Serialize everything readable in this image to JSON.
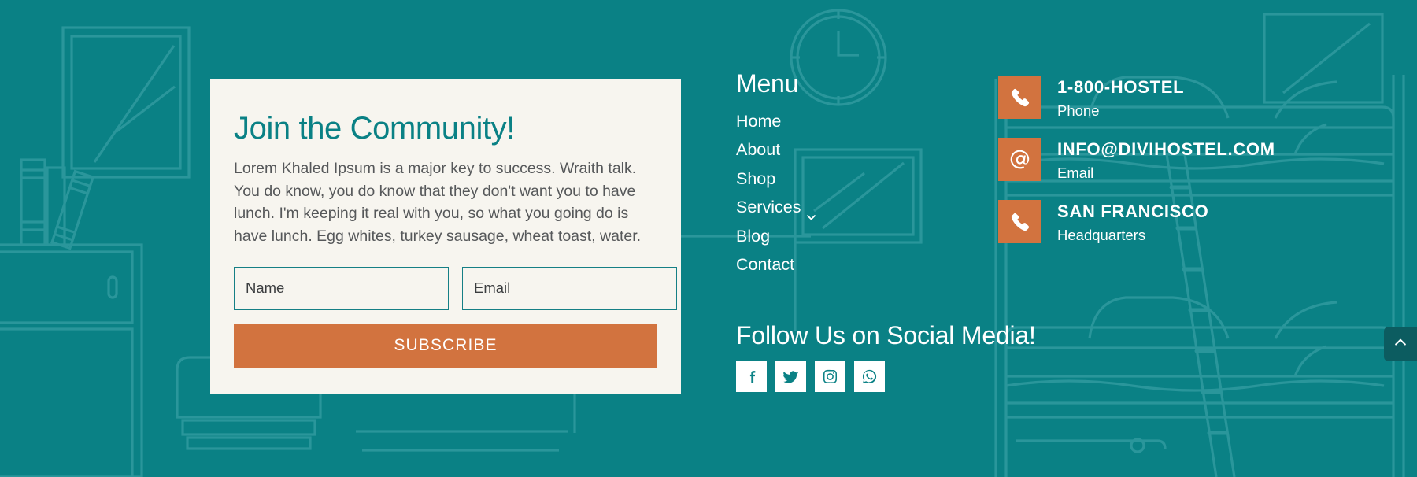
{
  "theme": {
    "teal": "#0a8185",
    "teal_dark": "#0c5c60",
    "orange": "#d2733f",
    "cream": "#f7f5ef",
    "white": "#ffffff",
    "body_text": "#56585a"
  },
  "subscribe_card": {
    "title": "Join the Community!",
    "body": "Lorem Khaled Ipsum is a major key to success. Wraith talk. You do know, you do know that they don't want you to have lunch. I'm keeping it real with you, so what you going do is have lunch. Egg whites, turkey sausage, wheat toast, water.",
    "name_field": {
      "value": "",
      "placeholder": "Name"
    },
    "email_field": {
      "value": "",
      "placeholder": "Email"
    },
    "submit_label": "SUBSCRIBE"
  },
  "menu": {
    "heading": "Menu",
    "items": [
      {
        "label": "Home",
        "has_submenu": false
      },
      {
        "label": "About",
        "has_submenu": false
      },
      {
        "label": "Shop",
        "has_submenu": false
      },
      {
        "label": "Services",
        "has_submenu": true
      },
      {
        "label": "Blog",
        "has_submenu": false
      },
      {
        "label": "Contact",
        "has_submenu": false
      }
    ]
  },
  "social": {
    "heading": "Follow Us on Social Media!",
    "links": [
      {
        "name": "facebook",
        "label": "Facebook"
      },
      {
        "name": "twitter",
        "label": "Twitter"
      },
      {
        "name": "instagram",
        "label": "Instagram"
      },
      {
        "name": "whatsapp",
        "label": "WhatsApp"
      }
    ]
  },
  "contact": {
    "items": [
      {
        "icon": "phone-icon",
        "title": "1-800-HOSTEL",
        "subtitle": "Phone"
      },
      {
        "icon": "at-sign-icon",
        "title": "INFO@DIVIHOSTEL.COM",
        "subtitle": "Email"
      },
      {
        "icon": "phone-icon",
        "title": "SAN FRANCISCO",
        "subtitle": "Headquarters"
      }
    ]
  },
  "scroll_top": {
    "label": "Scroll to top"
  }
}
